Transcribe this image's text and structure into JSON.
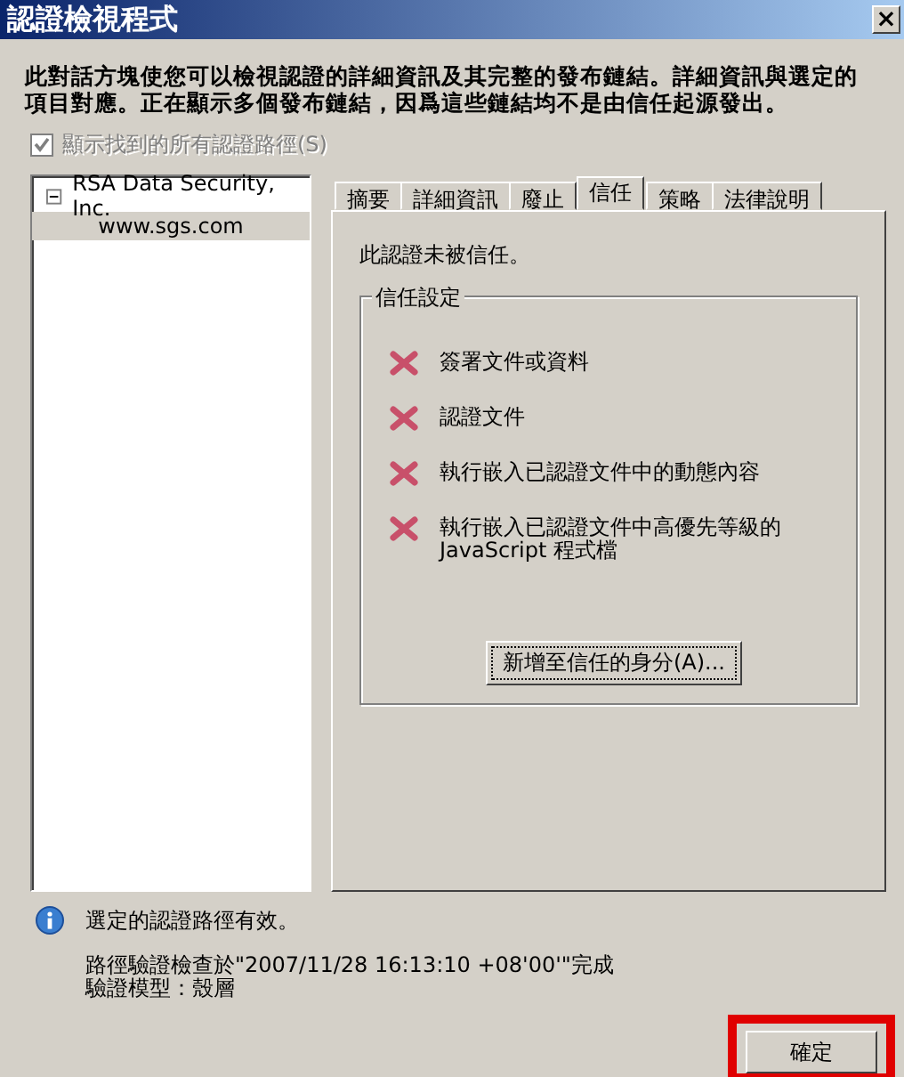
{
  "window": {
    "title": "認證檢視程式",
    "close": "×"
  },
  "description": "此對話方塊使您可以檢視認證的詳細資訊及其完整的發布鏈結。詳細資訊與選定的項目對應。正在顯示多個發布鏈結，因爲這些鏈結均不是由信任起源發出。",
  "show_all_paths": {
    "label": "顯示找到的所有認證路徑(S)",
    "checked": true,
    "disabled": true
  },
  "tree": [
    {
      "label": "RSA Data Security, Inc.",
      "expanded": true,
      "selected": false,
      "children": [
        {
          "label": "www.sgs.com",
          "selected": true
        }
      ]
    }
  ],
  "tabs": [
    {
      "label": "摘要",
      "selected": false
    },
    {
      "label": "詳細資訊",
      "selected": false
    },
    {
      "label": "廢止",
      "selected": false
    },
    {
      "label": "信任",
      "selected": true
    },
    {
      "label": "策略",
      "selected": false
    },
    {
      "label": "法律說明",
      "selected": false
    }
  ],
  "trust_status": "此認證未被信任。",
  "trust_settings": {
    "title": "信任設定",
    "items": [
      {
        "label": "簽署文件或資料",
        "allowed": false
      },
      {
        "label": "認證文件",
        "allowed": false
      },
      {
        "label": "執行嵌入已認證文件中的動態內容",
        "allowed": false
      },
      {
        "label": "執行嵌入已認證文件中高優先等級的\nJavaScript 程式檔",
        "allowed": false
      }
    ],
    "button": "新增至信任的身分(A)..."
  },
  "status": {
    "message": "選定的認證路徑有效。",
    "details": [
      "路徑驗證檢查於\"2007/11/28 16:13:10 +08'00'\"完成",
      "驗證模型：殼層"
    ]
  },
  "ok_button": {
    "label": "確定",
    "highlighted": true
  }
}
